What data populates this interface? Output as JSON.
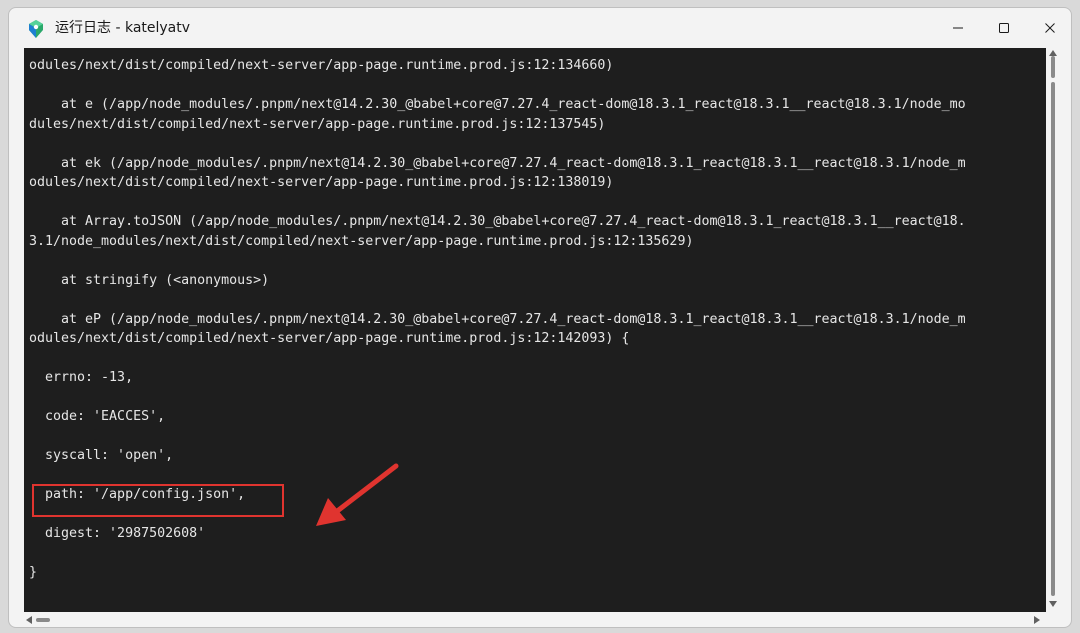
{
  "window": {
    "title": "运行日志 - katelyatv"
  },
  "icons": {
    "app": "app-icon",
    "minimize": "minimize-icon",
    "maximize": "maximize-icon",
    "close": "close-icon",
    "annotation": "arrow-icon"
  },
  "colors": {
    "terminal_bg": "#1e1e1e",
    "terminal_text": "#e6e6e6",
    "highlight": "#e0342f"
  },
  "log": {
    "lines": [
      "odules/next/dist/compiled/next-server/app-page.runtime.prod.js:12:134660)",
      "",
      "    at e (/app/node_modules/.pnpm/next@14.2.30_@babel+core@7.27.4_react-dom@18.3.1_react@18.3.1__react@18.3.1/node_mo",
      "dules/next/dist/compiled/next-server/app-page.runtime.prod.js:12:137545)",
      "",
      "    at ek (/app/node_modules/.pnpm/next@14.2.30_@babel+core@7.27.4_react-dom@18.3.1_react@18.3.1__react@18.3.1/node_m",
      "odules/next/dist/compiled/next-server/app-page.runtime.prod.js:12:138019)",
      "",
      "    at Array.toJSON (/app/node_modules/.pnpm/next@14.2.30_@babel+core@7.27.4_react-dom@18.3.1_react@18.3.1__react@18.",
      "3.1/node_modules/next/dist/compiled/next-server/app-page.runtime.prod.js:12:135629)",
      "",
      "    at stringify (<anonymous>)",
      "",
      "    at eP (/app/node_modules/.pnpm/next@14.2.30_@babel+core@7.27.4_react-dom@18.3.1_react@18.3.1__react@18.3.1/node_m",
      "odules/next/dist/compiled/next-server/app-page.runtime.prod.js:12:142093) {",
      "",
      "  errno: -13,",
      "",
      "  code: 'EACCES',",
      "",
      "  syscall: 'open',",
      "",
      "  path: '/app/config.json',",
      "",
      "  digest: '2987502608'",
      "",
      "}"
    ]
  }
}
